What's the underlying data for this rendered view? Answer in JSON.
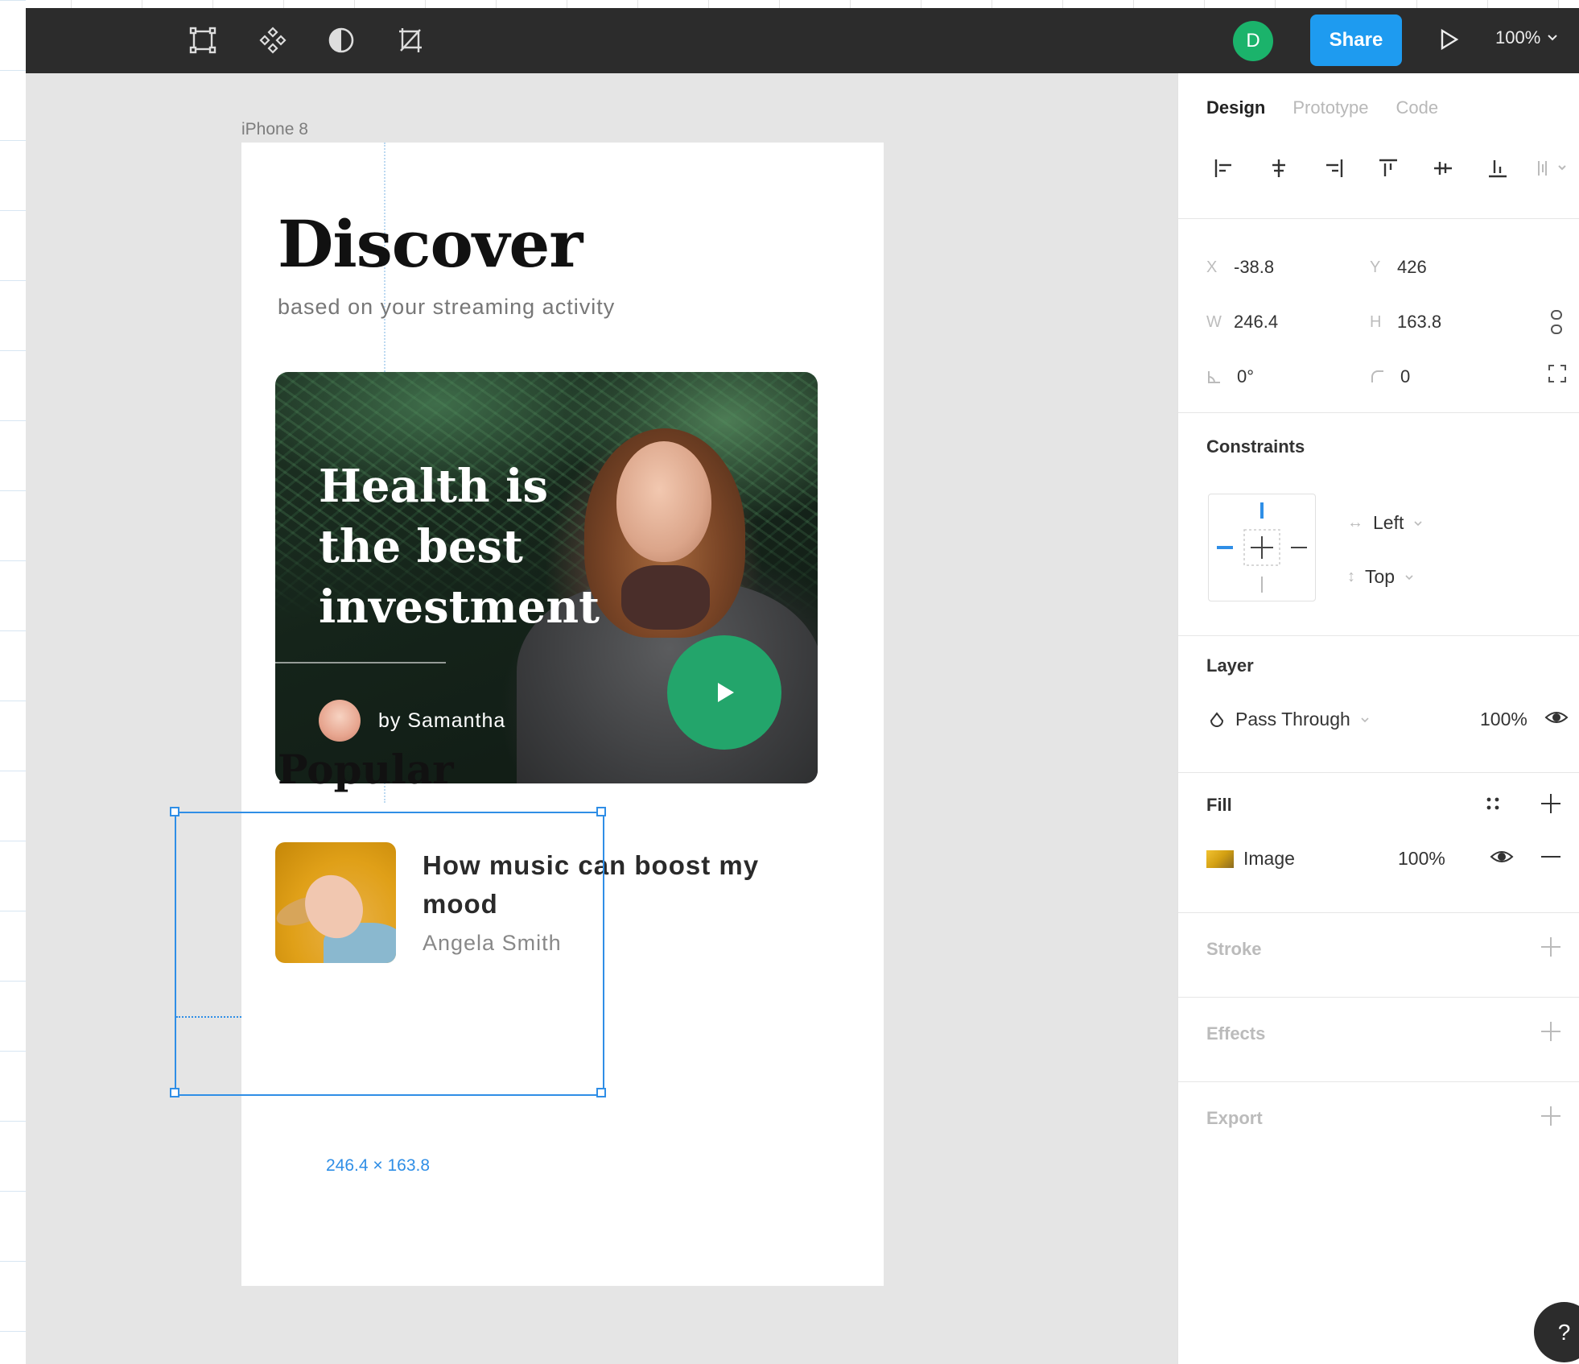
{
  "toolbar": {
    "tools": [
      "frame-icon",
      "component-icon",
      "contrast-icon",
      "crop-icon"
    ],
    "user_initial": "D",
    "share_label": "Share",
    "zoom_label": "100%"
  },
  "canvas": {
    "frame_label": "iPhone 8",
    "heading": "Discover",
    "subtitle": "based on your streaming activity",
    "hero": {
      "title": "Health is the best investment",
      "author": "by Samantha"
    },
    "popular_heading": "Popular",
    "card": {
      "title": "How music can boost my mood",
      "author": "Angela Smith"
    },
    "selection_size": "246.4 × 163.8"
  },
  "panel": {
    "tabs": [
      "Design",
      "Prototype",
      "Code"
    ],
    "active_tab": "Design",
    "x_label": "X",
    "x_value": "-38.8",
    "y_label": "Y",
    "y_value": "426",
    "w_label": "W",
    "w_value": "246.4",
    "h_label": "H",
    "h_value": "163.8",
    "rotation_value": "0°",
    "radius_value": "0",
    "constraints_title": "Constraints",
    "constraint_h": "Left",
    "constraint_v": "Top",
    "layer_title": "Layer",
    "blend_mode": "Pass Through",
    "layer_opacity": "100%",
    "fill_title": "Fill",
    "fill_type": "Image",
    "fill_opacity": "100%",
    "stroke_title": "Stroke",
    "effects_title": "Effects",
    "export_title": "Export"
  },
  "colors": {
    "accent": "#1e9bf0",
    "selection": "#2f8ee6",
    "play_green": "#23a56b",
    "toolbar_bg": "#2c2c2c"
  }
}
